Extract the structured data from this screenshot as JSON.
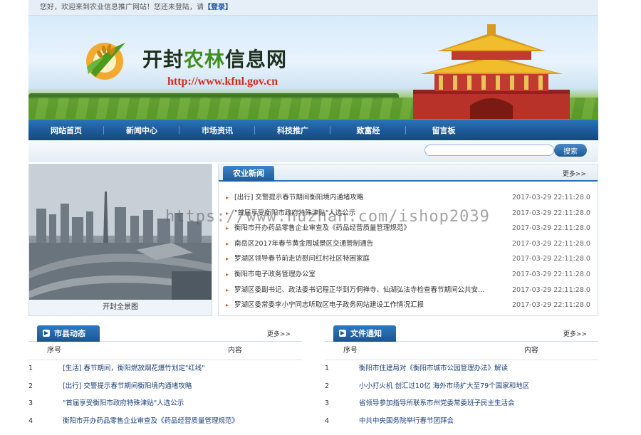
{
  "topbar": {
    "welcome": "您好，欢迎来到农业信息推广网站！您还未登陆，请",
    "login": "【登录】"
  },
  "banner": {
    "title_part1": "开封",
    "title_part2": "农林",
    "title_part3": "信息网",
    "url": "http://www.kfnl.gov.cn"
  },
  "nav": {
    "items": [
      "网站首页",
      "新闻中心",
      "市场资讯",
      "科技推广",
      "致富经",
      "留言板"
    ]
  },
  "search": {
    "placeholder": "",
    "button": "搜索"
  },
  "photo": {
    "caption": "开封全景图"
  },
  "agri_news": {
    "tab": "农业新闻",
    "more": "更多>>",
    "items": [
      {
        "title": "[出行] 交警提示春节期间衡阳境内通堵攻略",
        "date": "2017-03-29 22:11:28.0"
      },
      {
        "title": "\"首届享受衡阳市政府特殊津贴\"人选公示",
        "date": "2017-03-29 22:11:28.0"
      },
      {
        "title": "衡阳市开办药品零售企业审查及《药品经营质量管理规范》",
        "date": "2017-03-29 22:11:28.0"
      },
      {
        "title": "南岳区2017年春节黄金周城景区交通管制通告",
        "date": "2017-03-29 22:11:28.0"
      },
      {
        "title": "罗湖区领导春节前走访慰问红村社区特困家庭",
        "date": "2017-03-29 22:11:28.0"
      },
      {
        "title": "衡阳市电子政务管理办公室",
        "date": "2017-03-29 22:11:28.0"
      },
      {
        "title": "罗湖区委副书记、政法委书记程正华到万侗禅寺、仙湖弘法寺检查春节期间公共安…",
        "date": "2017-03-29 22:11:28.0"
      },
      {
        "title": "罗湖区委常委李小宁同志听取区电子政务网站建设工作情况汇报",
        "date": "2017-03-29 22:11:28.0"
      }
    ]
  },
  "county_news": {
    "tab": "市县动态",
    "more": "更多>>",
    "col_no": "序号",
    "col_content": "内容",
    "rows": [
      {
        "no": "1",
        "title": "[生活] 春节期间，衡阳燃放烟花爆竹划定\"红线\""
      },
      {
        "no": "2",
        "title": "[出行] 交警提示春节期间衡阳境内通堵攻略"
      },
      {
        "no": "3",
        "title": "\"首届享受衡阳市政府特殊津贴\"人选公示"
      },
      {
        "no": "4",
        "title": "衡阳市开办药品零售企业审查及《药品经营质量管理规范》"
      }
    ]
  },
  "documents": {
    "tab": "文件通知",
    "more": "更多>>",
    "col_no": "序号",
    "col_content": "内容",
    "rows": [
      {
        "no": "1",
        "title": "衡阳市住建局对《衡阳市城市公园管理办法》解读"
      },
      {
        "no": "2",
        "title": "小小打火机 创汇过10亿 海外市场扩大至79个国家和地区"
      },
      {
        "no": "3",
        "title": "省领导参加指导所联系市州党委常委班子民主生活会"
      },
      {
        "no": "4",
        "title": "中共中央国务院举行春节团拜会"
      }
    ]
  },
  "watermark": "https://www.huzhan.com/ishop2039",
  "colors": {
    "nav_blue": "#1c5a98",
    "tab_blue": "#2a6fb3",
    "url_red": "#d22b1b",
    "title_green": "#3f8f1e"
  }
}
